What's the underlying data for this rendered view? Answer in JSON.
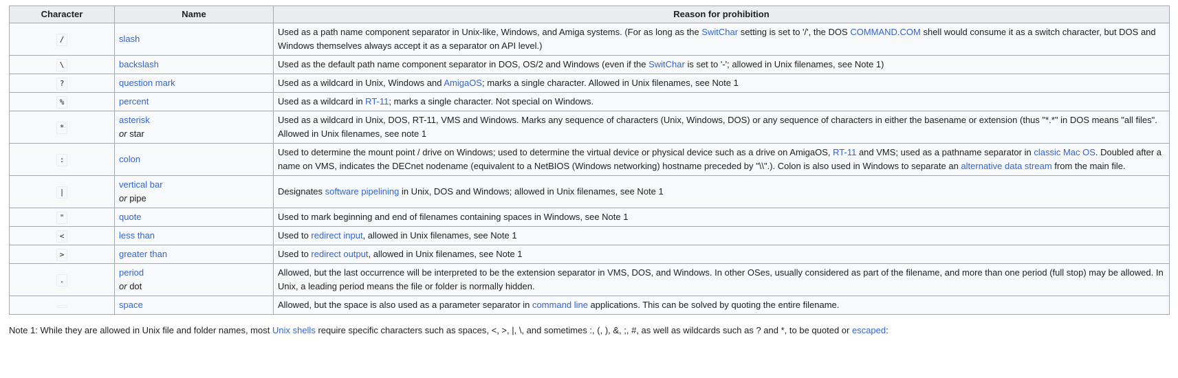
{
  "table": {
    "headers": [
      "Character",
      "Name",
      "Reason for prohibition"
    ],
    "rows": [
      {
        "char": "/",
        "name": "slash",
        "reason": [
          {
            "t": "Used as a path name component separator in Unix-like, Windows, and Amiga systems. (For as long as the "
          },
          {
            "t": "SwitChar",
            "link": true
          },
          {
            "t": " setting is set to '/', the DOS "
          },
          {
            "t": "COMMAND.COM",
            "link": true
          },
          {
            "t": " shell would consume it as a switch character, but DOS and Windows themselves always accept it as a separator on API level.)"
          }
        ]
      },
      {
        "char": "\\",
        "name": "backslash",
        "reason": [
          {
            "t": "Used as the default path name component separator in DOS, OS/2 and Windows (even if the "
          },
          {
            "t": "SwitChar",
            "link": true
          },
          {
            "t": " is set to '-'; allowed in Unix filenames, see Note 1)"
          }
        ]
      },
      {
        "char": "?",
        "name": "question mark",
        "reason": [
          {
            "t": "Used as a wildcard in Unix, Windows and "
          },
          {
            "t": "AmigaOS",
            "link": true
          },
          {
            "t": "; marks a single character. Allowed in Unix filenames, see Note 1"
          }
        ]
      },
      {
        "char": "%",
        "name": "percent",
        "reason": [
          {
            "t": "Used as a wildcard in "
          },
          {
            "t": "RT-11",
            "link": true
          },
          {
            "t": "; marks a single character. Not special on Windows."
          }
        ]
      },
      {
        "char": "*",
        "name": "asterisk",
        "alt_prefix": "or",
        "alt": "star",
        "reason": [
          {
            "t": "Used as a wildcard in Unix, DOS, RT-11, VMS and Windows. Marks any sequence of characters (Unix, Windows, DOS) or any sequence of characters in either the basename or extension (thus \"*.*\" in DOS means \"all files\". Allowed in Unix filenames, see note 1"
          }
        ]
      },
      {
        "char": ":",
        "name": "colon",
        "reason": [
          {
            "t": "Used to determine the mount point / drive on Windows; used to determine the virtual device or physical device such as a drive on AmigaOS, "
          },
          {
            "t": "RT-11",
            "link": true
          },
          {
            "t": " and VMS; used as a pathname separator in "
          },
          {
            "t": "classic Mac OS",
            "link": true
          },
          {
            "t": ". Doubled after a name on VMS, indicates the DECnet nodename (equivalent to a NetBIOS (Windows networking) hostname preceded by \"\\\\\".). Colon is also used in Windows to separate an "
          },
          {
            "t": "alternative data stream",
            "link": true
          },
          {
            "t": " from the main file."
          }
        ]
      },
      {
        "char": "|",
        "name": "vertical bar",
        "alt_prefix": "or",
        "alt": "pipe",
        "reason": [
          {
            "t": "Designates "
          },
          {
            "t": "software pipelining",
            "link": true
          },
          {
            "t": " in Unix, DOS and Windows; allowed in Unix filenames, see Note 1"
          }
        ]
      },
      {
        "char": "\"",
        "name": "quote",
        "reason": [
          {
            "t": "Used to mark beginning and end of filenames containing spaces in Windows, see Note 1"
          }
        ]
      },
      {
        "char": "<",
        "name": "less than",
        "reason": [
          {
            "t": "Used to "
          },
          {
            "t": "redirect input",
            "link": true
          },
          {
            "t": ", allowed in Unix filenames, see Note 1"
          }
        ]
      },
      {
        "char": ">",
        "name": "greater than",
        "reason": [
          {
            "t": "Used to "
          },
          {
            "t": "redirect output",
            "link": true
          },
          {
            "t": ", allowed in Unix filenames, see Note 1"
          }
        ]
      },
      {
        "char": ".",
        "name": "period",
        "alt_prefix": "or",
        "alt": "dot",
        "reason": [
          {
            "t": "Allowed, but the last occurrence will be interpreted to be the extension separator in VMS, DOS, and Windows. In other OSes, usually considered as part of the filename, and more than one period (full stop) may be allowed. In Unix, a leading period means the file or folder is normally hidden."
          }
        ]
      },
      {
        "char": " ",
        "name": "space",
        "reason": [
          {
            "t": "Allowed, but the space is also used as a parameter separator in "
          },
          {
            "t": "command line",
            "link": true
          },
          {
            "t": " applications. This can be solved by quoting the entire filename."
          }
        ]
      }
    ]
  },
  "note": [
    {
      "t": "Note 1: While they are allowed in Unix file and folder names, most "
    },
    {
      "t": "Unix shells",
      "link": true
    },
    {
      "t": " require specific characters such as spaces, <, >, |, \\, and sometimes :, (, ), &, ;, #, as well as wildcards such as ? and *, to be quoted or "
    },
    {
      "t": "escaped",
      "link": true
    },
    {
      "t": ":"
    }
  ],
  "colors": {
    "link": "#3366cc",
    "header_bg": "#eaecf0",
    "border": "#a2a9b1",
    "cell_bg": "#f8f9fa"
  }
}
